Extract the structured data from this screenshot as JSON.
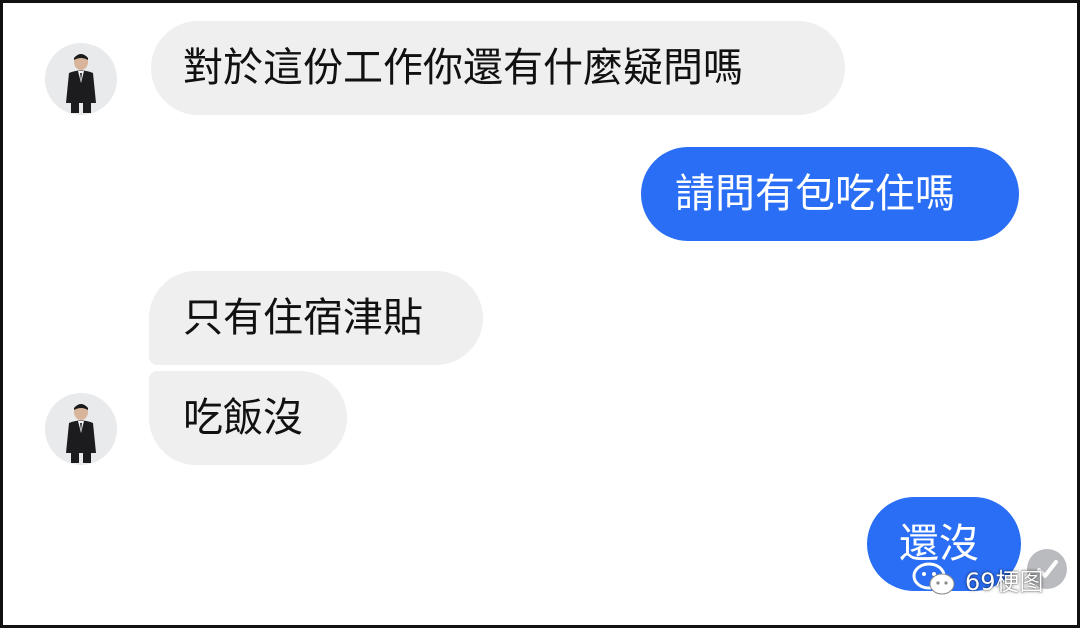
{
  "messages": [
    {
      "side": "incoming",
      "text": "對於這份工作你還有什麼疑問嗎"
    },
    {
      "side": "outgoing",
      "text": "請問有包吃住嗎"
    },
    {
      "side": "incoming",
      "text": "只有住宿津貼"
    },
    {
      "side": "incoming",
      "text": "吃飯沒"
    },
    {
      "side": "outgoing",
      "text": "還沒"
    }
  ],
  "watermark": {
    "text": "69梗图",
    "icon": "wechat-icon"
  },
  "colors": {
    "outgoing_bubble": "#2a6ef5",
    "incoming_bubble": "#efeff0",
    "seen_indicator": "#b9bbbe"
  }
}
